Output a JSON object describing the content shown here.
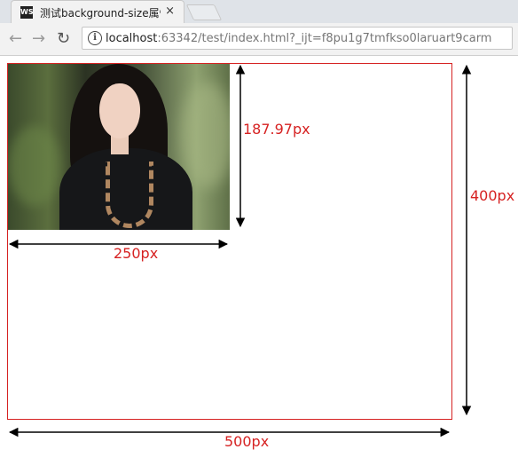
{
  "browser": {
    "tab_icon_text": "WS",
    "tab_title": "测试background-size属性",
    "tab_close": "×",
    "url_host": "localhost",
    "url_rest": ":63342/test/index.html?_ijt=f8pu1g7tmfkso0laruart9carm",
    "info_glyph": "i"
  },
  "page": {
    "image_width_label": "250px",
    "image_height_label": "187.97px",
    "box_width_label": "500px",
    "box_height_label": "400px"
  },
  "icons": [
    "ws-app-icon",
    "close-icon",
    "back-icon",
    "forward-icon",
    "reload-icon",
    "info-icon"
  ],
  "colors": {
    "accent": "#d62222",
    "border": "#d62222",
    "tab_bg": "#f2f2f2",
    "toolbar_bg": "#f2f2f2"
  }
}
